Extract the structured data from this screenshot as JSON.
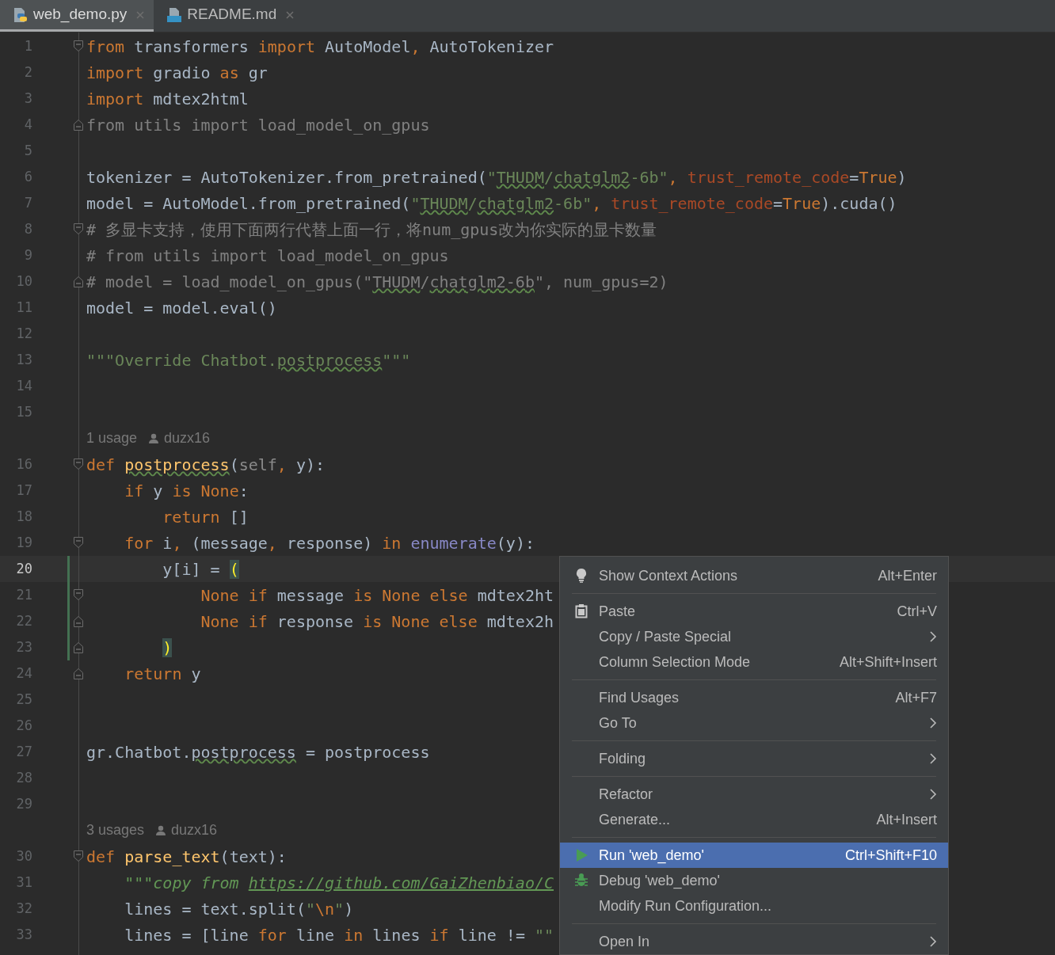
{
  "tabs": [
    {
      "label": "web_demo.py",
      "selected": true
    },
    {
      "label": "README.md",
      "selected": false
    }
  ],
  "editor": {
    "lines": [
      {
        "kind": "code",
        "number": "1",
        "fold_start": true,
        "segments": [
          {
            "kind": "keyword",
            "text": "from "
          },
          {
            "kind": "plain",
            "text": "transformers "
          },
          {
            "kind": "keyword",
            "text": "import "
          },
          {
            "kind": "plain",
            "text": "AutoModel"
          },
          {
            "kind": "keyword",
            "text": ", "
          },
          {
            "kind": "plain",
            "text": "AutoTokenizer"
          }
        ]
      },
      {
        "kind": "code",
        "number": "2",
        "segments": [
          {
            "kind": "keyword",
            "text": "import "
          },
          {
            "kind": "plain",
            "text": "gradio "
          },
          {
            "kind": "keyword",
            "text": "as "
          },
          {
            "kind": "plain",
            "text": "gr"
          }
        ]
      },
      {
        "kind": "code",
        "number": "3",
        "segments": [
          {
            "kind": "keyword",
            "text": "import "
          },
          {
            "kind": "plain",
            "text": "mdtex2html"
          }
        ]
      },
      {
        "kind": "code",
        "number": "4",
        "fold_end": true,
        "segments": [
          {
            "kind": "unused",
            "text": "from utils import load_model_on_gpus"
          }
        ]
      },
      {
        "kind": "code",
        "number": "5"
      },
      {
        "kind": "code",
        "number": "6",
        "segments": [
          {
            "kind": "plain",
            "text": "tokenizer = AutoTokenizer.from_pretrained("
          },
          {
            "kind": "string",
            "text": "\""
          },
          {
            "kind": "string-typo",
            "text": "THUDM"
          },
          {
            "kind": "string",
            "text": "/"
          },
          {
            "kind": "string-typo",
            "text": "chatglm2"
          },
          {
            "kind": "string",
            "text": "-6b\""
          },
          {
            "kind": "keyword",
            "text": ", "
          },
          {
            "kind": "param",
            "text": "trust_remote_code"
          },
          {
            "kind": "plain",
            "text": "="
          },
          {
            "kind": "keyword",
            "text": "True"
          },
          {
            "kind": "plain",
            "text": ")"
          }
        ]
      },
      {
        "kind": "code",
        "number": "7",
        "segments": [
          {
            "kind": "plain",
            "text": "model = AutoModel.from_pretrained("
          },
          {
            "kind": "string",
            "text": "\""
          },
          {
            "kind": "string-typo",
            "text": "THUDM"
          },
          {
            "kind": "string",
            "text": "/"
          },
          {
            "kind": "string-typo",
            "text": "chatglm2"
          },
          {
            "kind": "string",
            "text": "-6b\""
          },
          {
            "kind": "keyword",
            "text": ", "
          },
          {
            "kind": "param",
            "text": "trust_remote_code"
          },
          {
            "kind": "plain",
            "text": "="
          },
          {
            "kind": "keyword",
            "text": "True"
          },
          {
            "kind": "plain",
            "text": ").cuda()"
          }
        ]
      },
      {
        "kind": "code",
        "number": "8",
        "fold_start": true,
        "segments": [
          {
            "kind": "comment",
            "text": "# 多显卡支持，使用下面两行代替上面一行，将num_gpus改为你实际的显卡数量"
          }
        ]
      },
      {
        "kind": "code",
        "number": "9",
        "segments": [
          {
            "kind": "comment",
            "text": "# from utils import load_model_on_gpus"
          }
        ]
      },
      {
        "kind": "code",
        "number": "10",
        "fold_end": true,
        "segments": [
          {
            "kind": "comment",
            "text": "# model = load_model_on_gpus(\""
          },
          {
            "kind": "comment-typo",
            "text": "THUDM"
          },
          {
            "kind": "comment",
            "text": "/"
          },
          {
            "kind": "comment-typo",
            "text": "chatglm2-6b"
          },
          {
            "kind": "comment",
            "text": "\", num_gpus=2)"
          }
        ]
      },
      {
        "kind": "code",
        "number": "11",
        "segments": [
          {
            "kind": "plain",
            "text": "model = model.eval()"
          }
        ]
      },
      {
        "kind": "code",
        "number": "12"
      },
      {
        "kind": "code",
        "number": "13",
        "segments": [
          {
            "kind": "string",
            "text": "\"\"\"Override Chatbot."
          },
          {
            "kind": "string-typo",
            "text": "postprocess"
          },
          {
            "kind": "string",
            "text": "\"\"\""
          }
        ]
      },
      {
        "kind": "code",
        "number": "14"
      },
      {
        "kind": "code",
        "number": "15"
      },
      {
        "kind": "hint",
        "usages": "1 usage",
        "author": "duzx16"
      },
      {
        "kind": "code",
        "number": "16",
        "fold_start": true,
        "segments": [
          {
            "kind": "keyword",
            "text": "def "
          },
          {
            "kind": "def-typo",
            "text": "postprocess"
          },
          {
            "kind": "plain",
            "text": "("
          },
          {
            "kind": "self",
            "text": "self"
          },
          {
            "kind": "keyword",
            "text": ", "
          },
          {
            "kind": "plain",
            "text": "y):"
          }
        ]
      },
      {
        "kind": "code",
        "number": "17",
        "segments": [
          {
            "kind": "keyword",
            "text": "    if "
          },
          {
            "kind": "plain",
            "text": "y "
          },
          {
            "kind": "keyword",
            "text": "is None"
          },
          {
            "kind": "plain",
            "text": ":"
          }
        ]
      },
      {
        "kind": "code",
        "number": "18",
        "segments": [
          {
            "kind": "keyword",
            "text": "        return "
          },
          {
            "kind": "plain",
            "text": "[]"
          }
        ]
      },
      {
        "kind": "code",
        "number": "19",
        "fold_start": true,
        "segments": [
          {
            "kind": "keyword",
            "text": "    for "
          },
          {
            "kind": "plain",
            "text": "i"
          },
          {
            "kind": "keyword",
            "text": ", "
          },
          {
            "kind": "plain",
            "text": "(message"
          },
          {
            "kind": "keyword",
            "text": ", "
          },
          {
            "kind": "plain",
            "text": "response) "
          },
          {
            "kind": "keyword",
            "text": "in "
          },
          {
            "kind": "builtin",
            "text": "enumerate"
          },
          {
            "kind": "plain",
            "text": "(y):"
          }
        ]
      },
      {
        "kind": "code",
        "number": "20",
        "current": true,
        "changed": true,
        "segments": [
          {
            "kind": "plain",
            "text": "        y[i] = "
          },
          {
            "kind": "brace",
            "text": "("
          }
        ]
      },
      {
        "kind": "code",
        "number": "21",
        "fold_start": true,
        "changed": true,
        "segments": [
          {
            "kind": "keyword",
            "text": "            None if "
          },
          {
            "kind": "plain",
            "text": "message "
          },
          {
            "kind": "keyword",
            "text": "is None else "
          },
          {
            "kind": "plain",
            "text": "mdtex2ht"
          }
        ]
      },
      {
        "kind": "code",
        "number": "22",
        "fold_end": true,
        "changed": true,
        "segments": [
          {
            "kind": "keyword",
            "text": "            None if "
          },
          {
            "kind": "plain",
            "text": "response "
          },
          {
            "kind": "keyword",
            "text": "is None else "
          },
          {
            "kind": "plain",
            "text": "mdtex2h"
          }
        ]
      },
      {
        "kind": "code",
        "number": "23",
        "fold_end": true,
        "changed": true,
        "segments": [
          {
            "kind": "brace",
            "text": "        )"
          }
        ]
      },
      {
        "kind": "code",
        "number": "24",
        "fold_end": true,
        "segments": [
          {
            "kind": "keyword",
            "text": "    return "
          },
          {
            "kind": "plain",
            "text": "y"
          }
        ]
      },
      {
        "kind": "code",
        "number": "25"
      },
      {
        "kind": "code",
        "number": "26"
      },
      {
        "kind": "code",
        "number": "27",
        "segments": [
          {
            "kind": "plain",
            "text": "gr.Chatbot."
          },
          {
            "kind": "plain-typo",
            "text": "postprocess"
          },
          {
            "kind": "plain",
            "text": " = postprocess"
          }
        ]
      },
      {
        "kind": "code",
        "number": "28"
      },
      {
        "kind": "code",
        "number": "29"
      },
      {
        "kind": "hint",
        "usages": "3 usages",
        "author": "duzx16"
      },
      {
        "kind": "code",
        "number": "30",
        "fold_start": true,
        "segments": [
          {
            "kind": "keyword",
            "text": "def "
          },
          {
            "kind": "def",
            "text": "parse_text"
          },
          {
            "kind": "plain",
            "text": "(text):"
          }
        ]
      },
      {
        "kind": "code",
        "number": "31",
        "segments": [
          {
            "kind": "doc",
            "text": "    \"\"\"copy from "
          },
          {
            "kind": "link",
            "text": "https://github.com/GaiZhenbiao/C"
          }
        ]
      },
      {
        "kind": "code",
        "number": "32",
        "segments": [
          {
            "kind": "plain",
            "text": "    lines = text.split("
          },
          {
            "kind": "string",
            "text": "\""
          },
          {
            "kind": "escape",
            "text": "\\n"
          },
          {
            "kind": "string",
            "text": "\""
          },
          {
            "kind": "plain",
            "text": ")"
          }
        ]
      },
      {
        "kind": "code",
        "number": "33",
        "segments": [
          {
            "kind": "plain",
            "text": "    lines = [line "
          },
          {
            "kind": "keyword",
            "text": "for "
          },
          {
            "kind": "plain",
            "text": "line "
          },
          {
            "kind": "keyword",
            "text": "in "
          },
          {
            "kind": "plain",
            "text": "lines "
          },
          {
            "kind": "keyword",
            "text": "if "
          },
          {
            "kind": "plain",
            "text": "line != "
          },
          {
            "kind": "string",
            "text": "\"\""
          }
        ]
      }
    ]
  },
  "context_menu": {
    "groups": [
      {
        "items": [
          {
            "label": "Show Context Actions",
            "shortcut": "Alt+Enter",
            "submenu": false,
            "selected": false
          }
        ]
      },
      {
        "items": [
          {
            "label": "Paste",
            "shortcut": "Ctrl+V",
            "submenu": false,
            "selected": false
          },
          {
            "label": "Copy / Paste Special",
            "submenu": true,
            "selected": false
          },
          {
            "label": "Column Selection Mode",
            "shortcut": "Alt+Shift+Insert",
            "submenu": false,
            "selected": false
          }
        ]
      },
      {
        "items": [
          {
            "label": "Find Usages",
            "shortcut": "Alt+F7",
            "submenu": false,
            "selected": false
          },
          {
            "label": "Go To",
            "submenu": true,
            "selected": false
          }
        ]
      },
      {
        "items": [
          {
            "label": "Folding",
            "submenu": true,
            "selected": false
          }
        ]
      },
      {
        "items": [
          {
            "label": "Refactor",
            "submenu": true,
            "selected": false
          },
          {
            "label": "Generate...",
            "shortcut": "Alt+Insert",
            "submenu": false,
            "selected": false
          }
        ]
      },
      {
        "items": [
          {
            "label": "Run 'web_demo'",
            "shortcut": "Ctrl+Shift+F10",
            "submenu": false,
            "selected": true
          },
          {
            "label": "Debug 'web_demo'",
            "submenu": false,
            "selected": false
          },
          {
            "label": "Modify Run Configuration...",
            "submenu": false,
            "selected": false
          }
        ]
      },
      {
        "items": [
          {
            "label": "Open In",
            "submenu": true,
            "selected": false
          }
        ]
      }
    ]
  }
}
